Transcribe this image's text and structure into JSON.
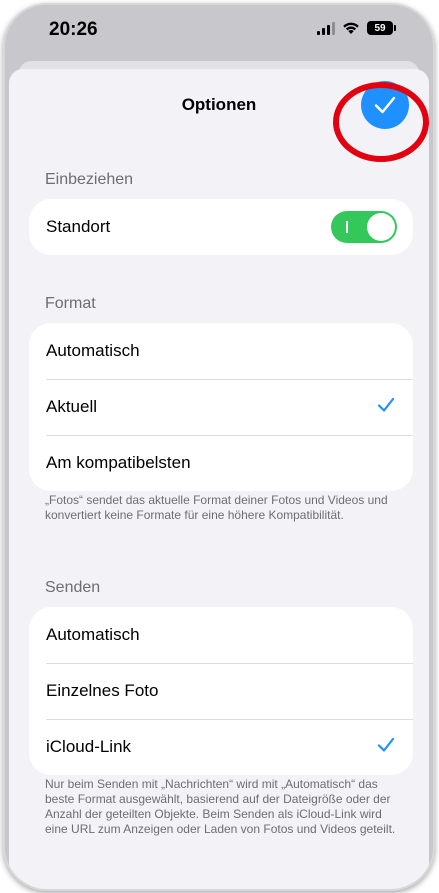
{
  "status_bar": {
    "time": "20:26",
    "battery": "59"
  },
  "sheet": {
    "title": "Optionen"
  },
  "sections": {
    "include": {
      "header": "Einbeziehen",
      "location_label": "Standort",
      "location_enabled": true
    },
    "format": {
      "header": "Format",
      "options": [
        "Automatisch",
        "Aktuell",
        "Am kompatibelsten"
      ],
      "selected": "Aktuell",
      "footnote": "„Fotos“ sendet das aktuelle Format deiner Fotos und Videos und konvertiert keine Formate für eine höhere Kompatibilität."
    },
    "send": {
      "header": "Senden",
      "options": [
        "Automatisch",
        "Einzelnes Foto",
        "iCloud-Link"
      ],
      "selected": "iCloud-Link",
      "footnote": "Nur beim Senden mit „Nachrichten“ wird mit „Automatisch“ das beste Format ausgewählt, basierend auf der Dateigröße oder der Anzahl der geteilten Objekte. Beim Senden als iCloud-Link wird eine URL zum Anzeigen oder Laden von Fotos und Videos geteilt."
    }
  },
  "colors": {
    "accent": "#1e90ff",
    "toggle_on": "#34c759",
    "highlight": "#e3000f"
  }
}
